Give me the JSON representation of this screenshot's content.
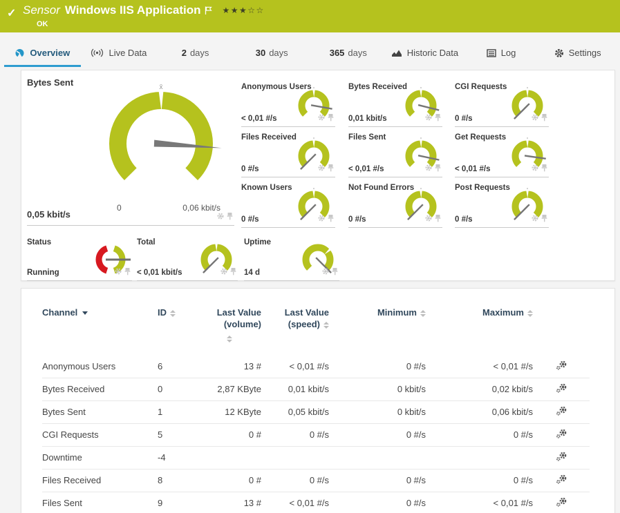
{
  "header": {
    "check_icon": "✓",
    "kind": "Sensor",
    "title": "Windows IIS Application",
    "status": "OK",
    "stars_filled": "★★★",
    "stars_empty": "☆☆"
  },
  "tabs": [
    {
      "label": "Overview",
      "icon": "gauge-icon",
      "active": true
    },
    {
      "label": "Live Data",
      "icon": "live-data-icon"
    },
    {
      "num": "2",
      "label": "days"
    },
    {
      "num": "30",
      "label": "days"
    },
    {
      "num": "365",
      "label": "days"
    },
    {
      "label": "Historic Data",
      "icon": "area-chart-icon"
    },
    {
      "label": "Log",
      "icon": "log-icon"
    },
    {
      "label": "Settings",
      "icon": "gear-icon"
    }
  ],
  "big_gauge": {
    "title": "Bytes Sent",
    "value": "0,05 kbit/s",
    "scale_min": "0",
    "scale_max": "0,06 kbit/s",
    "avg_marker": "x̄"
  },
  "mini_gauges": [
    {
      "title": "Anonymous Users",
      "value": "< 0,01 #/s"
    },
    {
      "title": "Bytes Received",
      "value": "0,01 kbit/s"
    },
    {
      "title": "CGI Requests",
      "value": "0 #/s"
    },
    {
      "title": "Files Received",
      "value": "0 #/s"
    },
    {
      "title": "Files Sent",
      "value": "< 0,01 #/s"
    },
    {
      "title": "Get Requests",
      "value": "< 0,01 #/s"
    },
    {
      "title": "Known Users",
      "value": "0 #/s"
    },
    {
      "title": "Not Found Errors",
      "value": "0 #/s"
    },
    {
      "title": "Post Requests",
      "value": "0 #/s"
    }
  ],
  "bottom_gauges": [
    {
      "title": "Status",
      "value": "Running"
    },
    {
      "title": "Total",
      "value": "< 0,01 kbit/s"
    },
    {
      "title": "Uptime",
      "value": "14 d"
    }
  ],
  "table": {
    "headers": {
      "channel": "Channel",
      "id": "ID",
      "last_value": "Last Value",
      "volume_sub": "(volume)",
      "speed_sub": "(speed)",
      "minimum": "Minimum",
      "maximum": "Maximum"
    },
    "rows": [
      {
        "channel": "Anonymous Users",
        "id": "6",
        "volume": "13 #",
        "speed": "< 0,01 #/s",
        "min": "0 #/s",
        "max": "< 0,01 #/s"
      },
      {
        "channel": "Bytes Received",
        "id": "0",
        "volume": "2,87 KByte",
        "speed": "0,01 kbit/s",
        "min": "0 kbit/s",
        "max": "0,02 kbit/s"
      },
      {
        "channel": "Bytes Sent",
        "id": "1",
        "volume": "12 KByte",
        "speed": "0,05 kbit/s",
        "min": "0 kbit/s",
        "max": "0,06 kbit/s"
      },
      {
        "channel": "CGI Requests",
        "id": "5",
        "volume": "0 #",
        "speed": "0 #/s",
        "min": "0 #/s",
        "max": "0 #/s"
      },
      {
        "channel": "Downtime",
        "id": "-4",
        "volume": "",
        "speed": "",
        "min": "",
        "max": ""
      },
      {
        "channel": "Files Received",
        "id": "8",
        "volume": "0 #",
        "speed": "0 #/s",
        "min": "0 #/s",
        "max": "0 #/s"
      },
      {
        "channel": "Files Sent",
        "id": "9",
        "volume": "13 #",
        "speed": "< 0,01 #/s",
        "min": "0 #/s",
        "max": "< 0,01 #/s"
      }
    ]
  },
  "colors": {
    "accent_green": "#b5c21e",
    "status_red": "#d71920",
    "active_tab_blue": "#2e9cd0"
  }
}
